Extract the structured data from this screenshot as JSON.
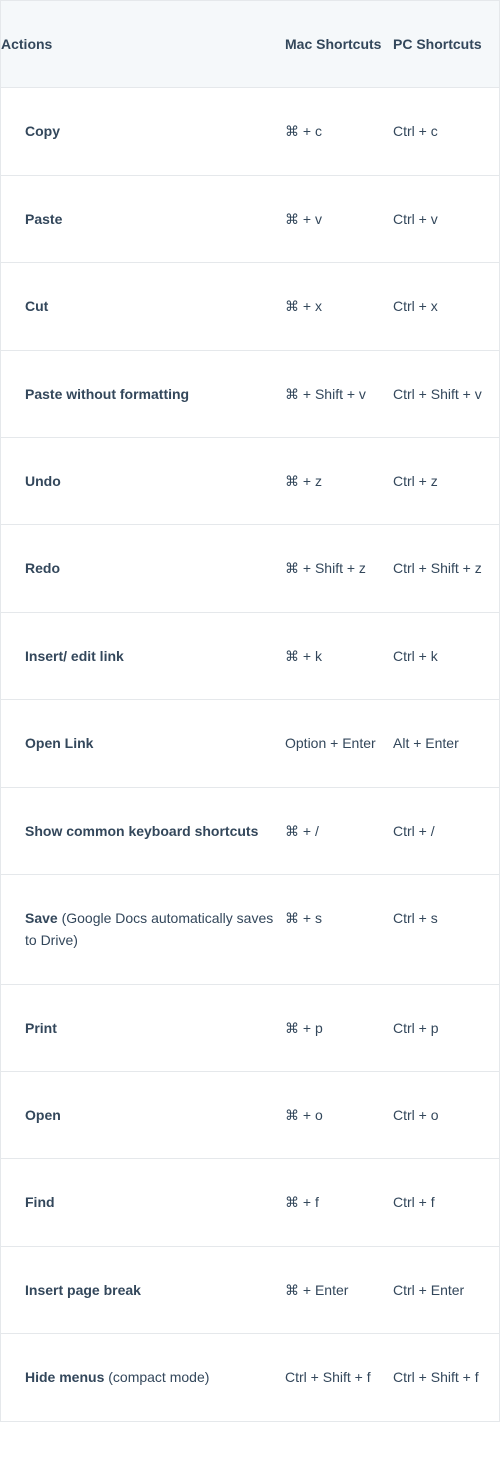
{
  "headers": {
    "actions": "Actions",
    "mac": "Mac Shortcuts",
    "pc": "PC Shortcuts"
  },
  "rows": [
    {
      "action_bold": "Copy",
      "action_rest": "",
      "mac": "⌘ + c",
      "pc": "Ctrl + c"
    },
    {
      "action_bold": "Paste",
      "action_rest": "",
      "mac": "⌘ + v",
      "pc": "Ctrl + v"
    },
    {
      "action_bold": "Cut",
      "action_rest": "",
      "mac": "⌘ + x",
      "pc": "Ctrl + x"
    },
    {
      "action_bold": "Paste without formatting",
      "action_rest": "",
      "mac": "⌘ + Shift + v",
      "pc": "Ctrl + Shift + v"
    },
    {
      "action_bold": "Undo",
      "action_rest": "",
      "mac": "⌘ + z",
      "pc": "Ctrl + z"
    },
    {
      "action_bold": "Redo",
      "action_rest": "",
      "mac": "⌘ + Shift + z",
      "pc": "Ctrl + Shift + z"
    },
    {
      "action_bold": "Insert/ edit link",
      "action_rest": "",
      "mac": "⌘ + k",
      "pc": "Ctrl + k"
    },
    {
      "action_bold": "Open Link",
      "action_rest": "",
      "mac": "Option + Enter",
      "pc": "Alt + Enter"
    },
    {
      "action_bold": "Show common keyboard shortcuts",
      "action_rest": "",
      "mac": "⌘ + /",
      "pc": "Ctrl + /"
    },
    {
      "action_bold": "Save",
      "action_rest": " (Google Docs automatically saves to Drive)",
      "mac": "⌘ + s",
      "pc": "Ctrl + s"
    },
    {
      "action_bold": "Print",
      "action_rest": "",
      "mac": "⌘ + p",
      "pc": "Ctrl + p"
    },
    {
      "action_bold": "Open",
      "action_rest": "",
      "mac": "⌘ + o",
      "pc": "Ctrl + o"
    },
    {
      "action_bold": "Find",
      "action_rest": "",
      "mac": "⌘ + f",
      "pc": "Ctrl + f"
    },
    {
      "action_bold": "Insert page break",
      "action_rest": "",
      "mac": "⌘ + Enter",
      "pc": "Ctrl + Enter"
    },
    {
      "action_bold": "Hide menus",
      "action_rest": " (compact mode)",
      "mac": "Ctrl + Shift + f",
      "pc": "Ctrl + Shift + f"
    }
  ]
}
